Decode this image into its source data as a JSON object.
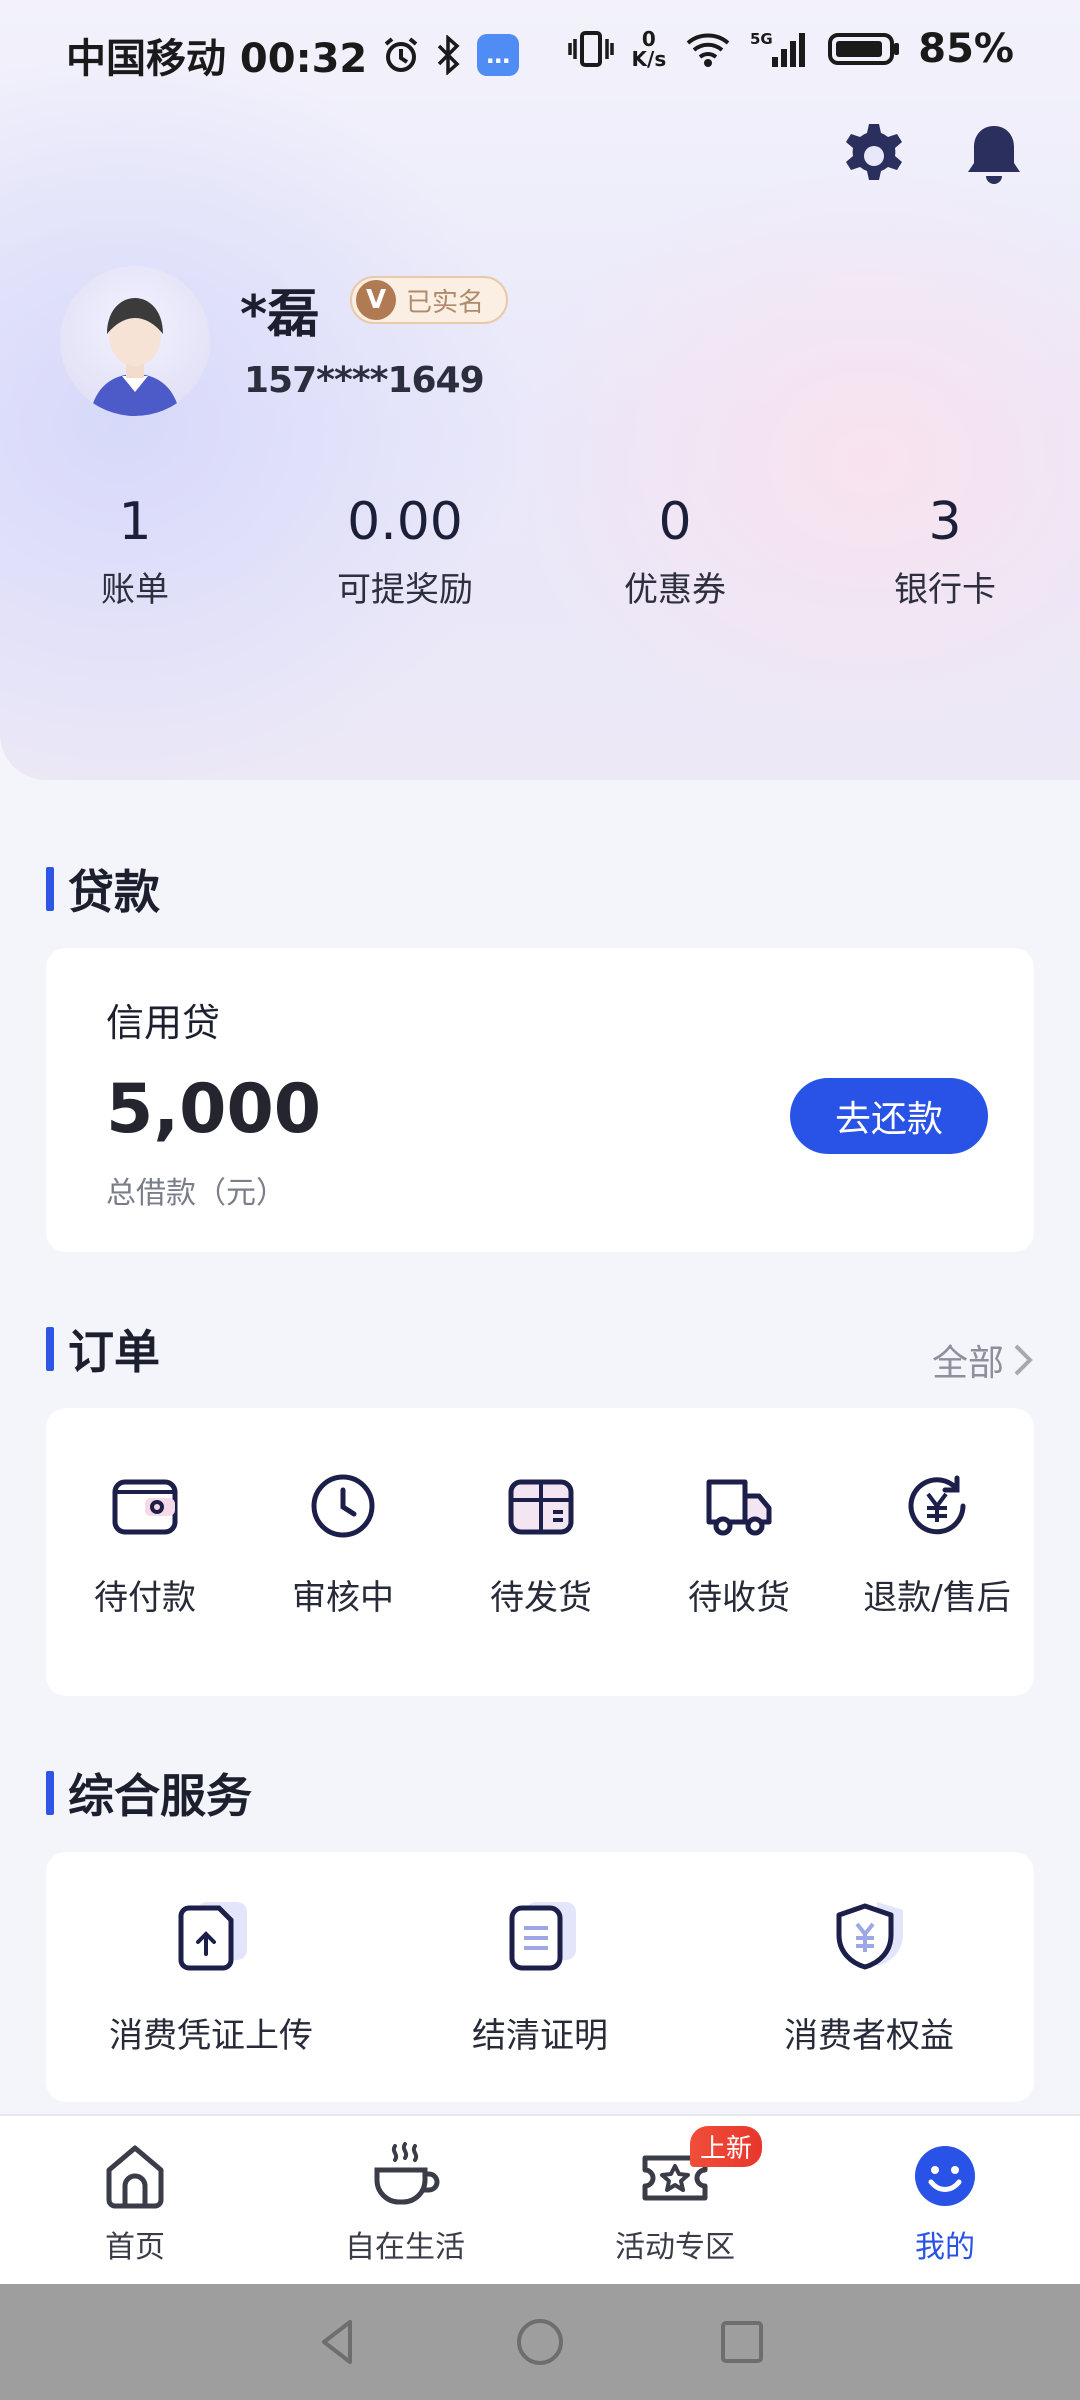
{
  "status_bar": {
    "carrier_time": "中国移动 00:32",
    "net_speed_top": "0",
    "net_speed_unit": "K/s",
    "signal_type": "5G",
    "battery": "85%"
  },
  "profile": {
    "name": "*磊",
    "verified_badge_letter": "V",
    "verified_label": "已实名",
    "phone": "157****1649"
  },
  "stats": [
    {
      "value": "1",
      "label": "账单"
    },
    {
      "value": "0.00",
      "label": "可提奖励"
    },
    {
      "value": "0",
      "label": "优惠券"
    },
    {
      "value": "3",
      "label": "银行卡"
    }
  ],
  "loan": {
    "section_title": "贷款",
    "type": "信用贷",
    "amount": "5,000",
    "amount_label": "总借款（元）",
    "repay_button": "去还款"
  },
  "orders": {
    "section_title": "订单",
    "all_link": "全部",
    "items": [
      {
        "label": "待付款",
        "icon": "wallet-icon"
      },
      {
        "label": "审核中",
        "icon": "clock-icon"
      },
      {
        "label": "待发货",
        "icon": "package-icon"
      },
      {
        "label": "待收货",
        "icon": "truck-icon"
      },
      {
        "label": "退款/售后",
        "icon": "refund-icon"
      }
    ]
  },
  "services": {
    "section_title": "综合服务",
    "items": [
      {
        "label": "消费凭证上传",
        "icon": "upload-document-icon"
      },
      {
        "label": "结清证明",
        "icon": "certificate-icon"
      },
      {
        "label": "消费者权益",
        "icon": "shield-yuan-icon"
      }
    ]
  },
  "bottom_nav": {
    "items": [
      {
        "label": "首页",
        "icon": "home-icon"
      },
      {
        "label": "自在生活",
        "icon": "coffee-cup-icon"
      },
      {
        "label": "活动专区",
        "icon": "ticket-star-icon",
        "badge": "上新"
      },
      {
        "label": "我的",
        "icon": "smiley-icon",
        "active": true
      }
    ]
  },
  "colors": {
    "accent": "#2853e6",
    "badge_red": "#e8362c"
  }
}
